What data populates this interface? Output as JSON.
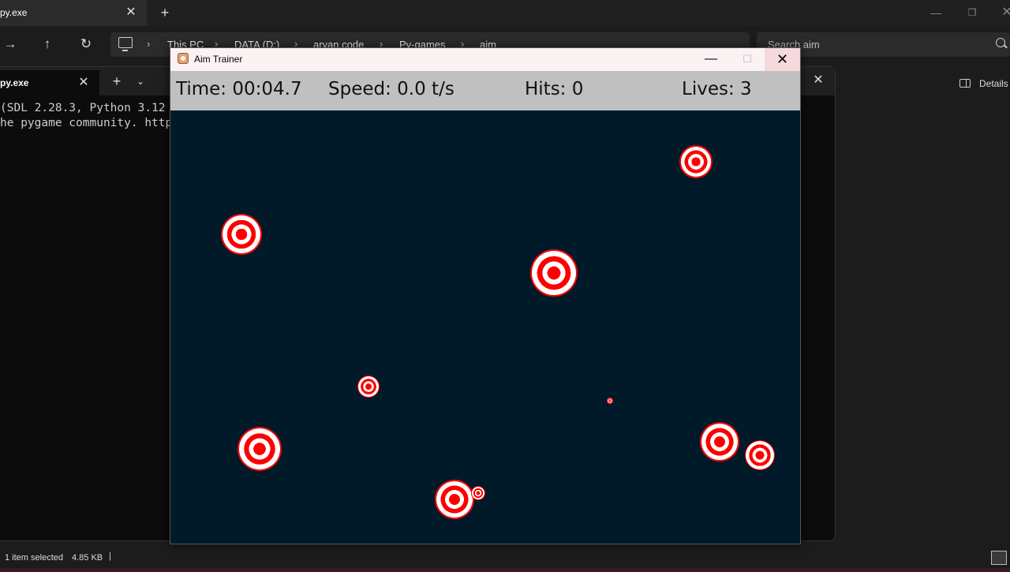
{
  "explorer": {
    "tab_title": "py.exe",
    "address": {
      "crumbs": [
        "This PC",
        "DATA (D:)",
        "aryan code",
        "Py-games",
        "aim"
      ]
    },
    "search_placeholder": "Search aim",
    "details_label": "Details",
    "status": {
      "selected": "1 item selected",
      "size": "4.85 KB"
    }
  },
  "terminal": {
    "tab_title": "py.exe",
    "lines": [
      "(SDL 2.28.3, Python 3.12",
      "he pygame community. http"
    ]
  },
  "aim_trainer": {
    "window_title": "Aim Trainer",
    "hud": {
      "time": "Time: 00:04.7",
      "speed": "Speed: 0.0 t/s",
      "hits": "Hits: 0",
      "lives": "Lives: 3"
    },
    "colors": {
      "background": "#001a2a",
      "target_red": "#ff0000",
      "target_white": "#ffffff",
      "hud_bg": "#c0c0c0"
    },
    "targets": [
      {
        "id": "target-1",
        "size": 38
      },
      {
        "id": "target-2",
        "size": 48
      },
      {
        "id": "target-3",
        "size": 56
      },
      {
        "id": "target-4",
        "size": 26
      },
      {
        "id": "target-5",
        "size": 6
      },
      {
        "id": "target-6",
        "size": 52
      },
      {
        "id": "target-7",
        "size": 46
      },
      {
        "id": "target-8",
        "size": 36
      },
      {
        "id": "target-9",
        "size": 46
      },
      {
        "id": "target-10",
        "size": 16
      }
    ]
  }
}
